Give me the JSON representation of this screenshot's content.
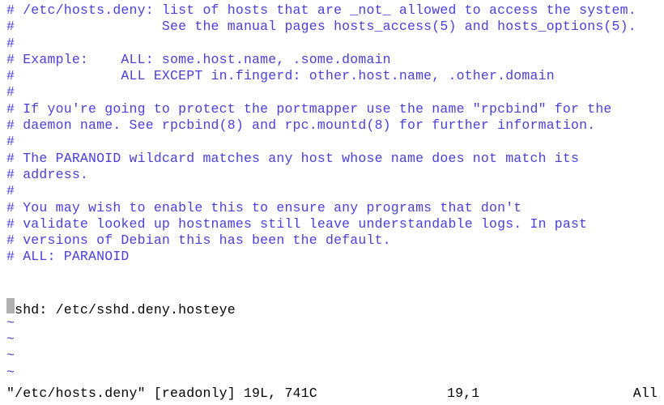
{
  "editor": {
    "comment_lines": [
      "# /etc/hosts.deny: list of hosts that are _not_ allowed to access the system.",
      "#                  See the manual pages hosts_access(5) and hosts_options(5).",
      "#",
      "# Example:    ALL: some.host.name, .some.domain",
      "#             ALL EXCEPT in.fingerd: other.host.name, .other.domain",
      "#",
      "# If you're going to protect the portmapper use the name \"rpcbind\" for the",
      "# daemon name. See rpcbind(8) and rpc.mountd(8) for further information.",
      "#",
      "# The PARANOID wildcard matches any host whose name does not match its",
      "# address.",
      "#",
      "# You may wish to enable this to ensure any programs that don't",
      "# validate looked up hostnames still leave understandable logs. In past",
      "# versions of Debian this has been the default.",
      "# ALL: PARANOID"
    ],
    "blank_lines_after_comments": 2,
    "content_line": "sshd: /etc/sshd.deny.hosteye",
    "tilde_count": 4
  },
  "status": {
    "filename_info": "\"/etc/hosts.deny\" [readonly] 19L, 741C",
    "position": "19,1",
    "scroll": "All"
  }
}
